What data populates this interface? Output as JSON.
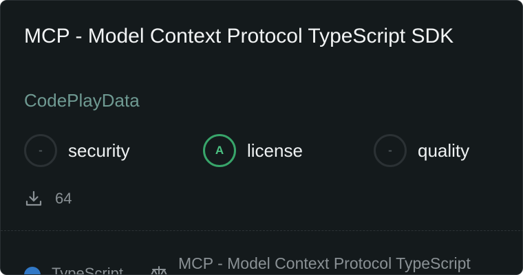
{
  "card": {
    "title": "MCP - Model Context Protocol TypeScript SDK",
    "author": "CodePlayData",
    "scores": [
      {
        "grade": "-",
        "label": "security"
      },
      {
        "grade": "A",
        "label": "license"
      },
      {
        "grade": "-",
        "label": "quality"
      }
    ],
    "downloads": "64",
    "language": "TypeScript",
    "footer_text": "MCP - Model Context Protocol TypeScript"
  },
  "colors": {
    "background": "#141a1c",
    "grade_a": "#38a56a",
    "author": "#6f9a92",
    "typescript": "#3178c6"
  },
  "icons": {
    "downloads": "download-icon",
    "license": "scale-icon"
  }
}
